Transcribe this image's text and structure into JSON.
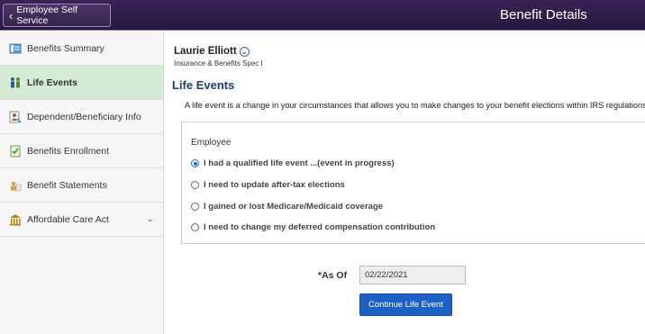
{
  "header": {
    "back_label": "Employee Self Service",
    "title": "Benefit Details"
  },
  "sidebar": {
    "items": [
      {
        "label": "Benefits Summary",
        "icon": "summary-icon",
        "active": false
      },
      {
        "label": "Life Events",
        "icon": "life-events-icon",
        "active": true
      },
      {
        "label": "Dependent/Beneficiary Info",
        "icon": "dependent-icon",
        "active": false
      },
      {
        "label": "Benefits Enrollment",
        "icon": "enrollment-icon",
        "active": false
      },
      {
        "label": "Benefit Statements",
        "icon": "statements-icon",
        "active": false
      },
      {
        "label": "Affordable Care Act",
        "icon": "building-icon",
        "active": false,
        "expandable": true
      }
    ]
  },
  "person": {
    "name": "Laurie Elliott",
    "role": "Insurance & Benefits Spec I"
  },
  "main": {
    "title": "Life Events",
    "description": "A life event is a change in your circumstances that allows you to make changes to your benefit elections within IRS regulations.",
    "group_label": "Employee",
    "options": [
      {
        "label": "I had a qualified life event ...(event in progress)",
        "checked": true
      },
      {
        "label": "I need to update after-tax elections",
        "checked": false
      },
      {
        "label": "I gained or lost Medicare/Medicaid coverage",
        "checked": false
      },
      {
        "label": "I need to change my deferred compensation contribution",
        "checked": false
      }
    ],
    "as_of_label": "*As Of",
    "as_of_value": "02/22/2021",
    "continue_label": "Continue Life Event"
  },
  "colors": {
    "header_bg": "#2f1f49",
    "active_item_bg": "#d5ebd5",
    "primary_button": "#1d61c5",
    "title_color": "#1d3d6e"
  }
}
